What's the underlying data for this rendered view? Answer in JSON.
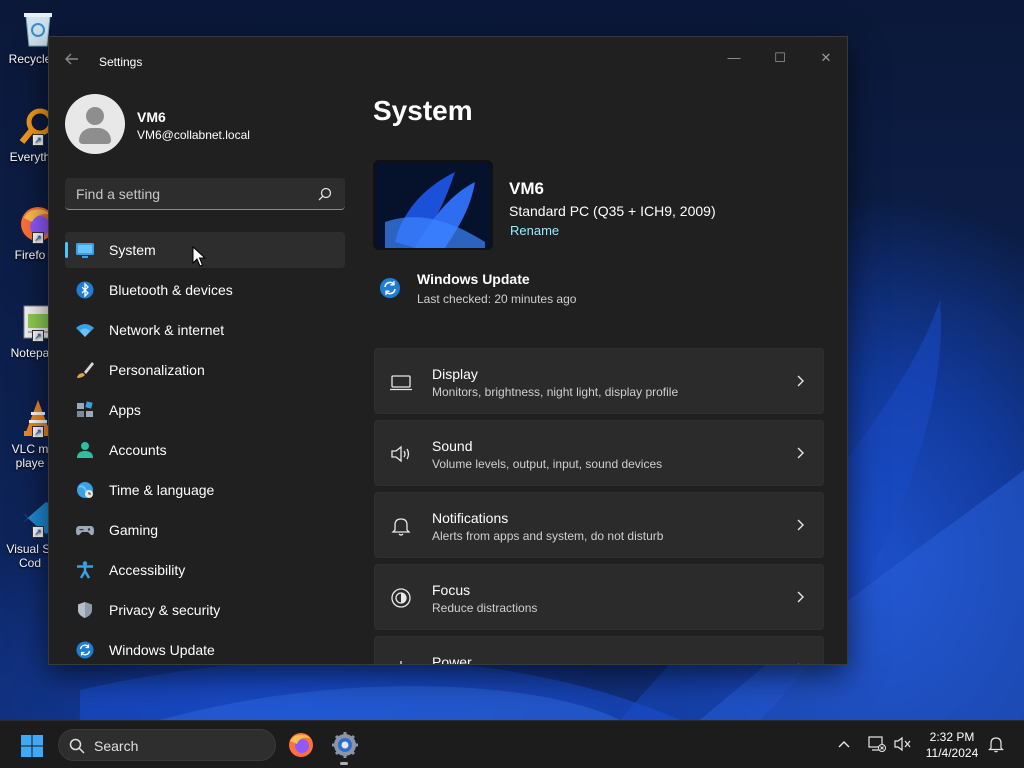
{
  "desktop": {
    "icons": [
      {
        "label": "Recycle",
        "icon": "recycle-bin-icon"
      },
      {
        "label": "Everyth",
        "icon": "everything-search-icon"
      },
      {
        "label": "Firefo",
        "icon": "firefox-icon"
      },
      {
        "label": "Notepa",
        "icon": "notepad-icon"
      },
      {
        "label": "VLC m",
        "label2": "playe",
        "icon": "vlc-icon"
      },
      {
        "label": "Visual St",
        "label2": "Cod",
        "icon": "vscode-icon"
      }
    ]
  },
  "window": {
    "title": "Settings",
    "controls": {
      "minimize": "—",
      "maximize": "☐",
      "close": "✕"
    }
  },
  "profile": {
    "name": "VM6",
    "email": "VM6@collabnet.local"
  },
  "search": {
    "placeholder": "Find a setting"
  },
  "nav": {
    "items": [
      {
        "label": "System",
        "icon": "monitor-icon",
        "active": true
      },
      {
        "label": "Bluetooth & devices",
        "icon": "bluetooth-icon"
      },
      {
        "label": "Network & internet",
        "icon": "wifi-icon"
      },
      {
        "label": "Personalization",
        "icon": "brush-icon"
      },
      {
        "label": "Apps",
        "icon": "apps-icon"
      },
      {
        "label": "Accounts",
        "icon": "person-icon"
      },
      {
        "label": "Time & language",
        "icon": "globe-clock-icon"
      },
      {
        "label": "Gaming",
        "icon": "gamepad-icon"
      },
      {
        "label": "Accessibility",
        "icon": "accessibility-icon"
      },
      {
        "label": "Privacy & security",
        "icon": "shield-icon"
      },
      {
        "label": "Windows Update",
        "icon": "update-icon"
      }
    ]
  },
  "main": {
    "title": "System",
    "device": {
      "name": "VM6",
      "model": "Standard PC (Q35 + ICH9, 2009)",
      "rename": "Rename"
    },
    "windows_update": {
      "title": "Windows Update",
      "subtitle": "Last checked: 20 minutes ago"
    },
    "cards": [
      {
        "title": "Display",
        "subtitle": "Monitors, brightness, night light, display profile",
        "icon": "display-icon"
      },
      {
        "title": "Sound",
        "subtitle": "Volume levels, output, input, sound devices",
        "icon": "speaker-icon"
      },
      {
        "title": "Notifications",
        "subtitle": "Alerts from apps and system, do not disturb",
        "icon": "bell-icon"
      },
      {
        "title": "Focus",
        "subtitle": "Reduce distractions",
        "icon": "focus-icon"
      },
      {
        "title": "Power",
        "subtitle": "",
        "icon": "power-icon"
      }
    ]
  },
  "taskbar": {
    "search_label": "Search",
    "time": "2:32 PM",
    "date": "11/4/2024"
  },
  "colors": {
    "accent": "#4cc2ff",
    "link": "#99ebff",
    "window_bg": "#202020",
    "card_bg": "#2b2b2b"
  }
}
